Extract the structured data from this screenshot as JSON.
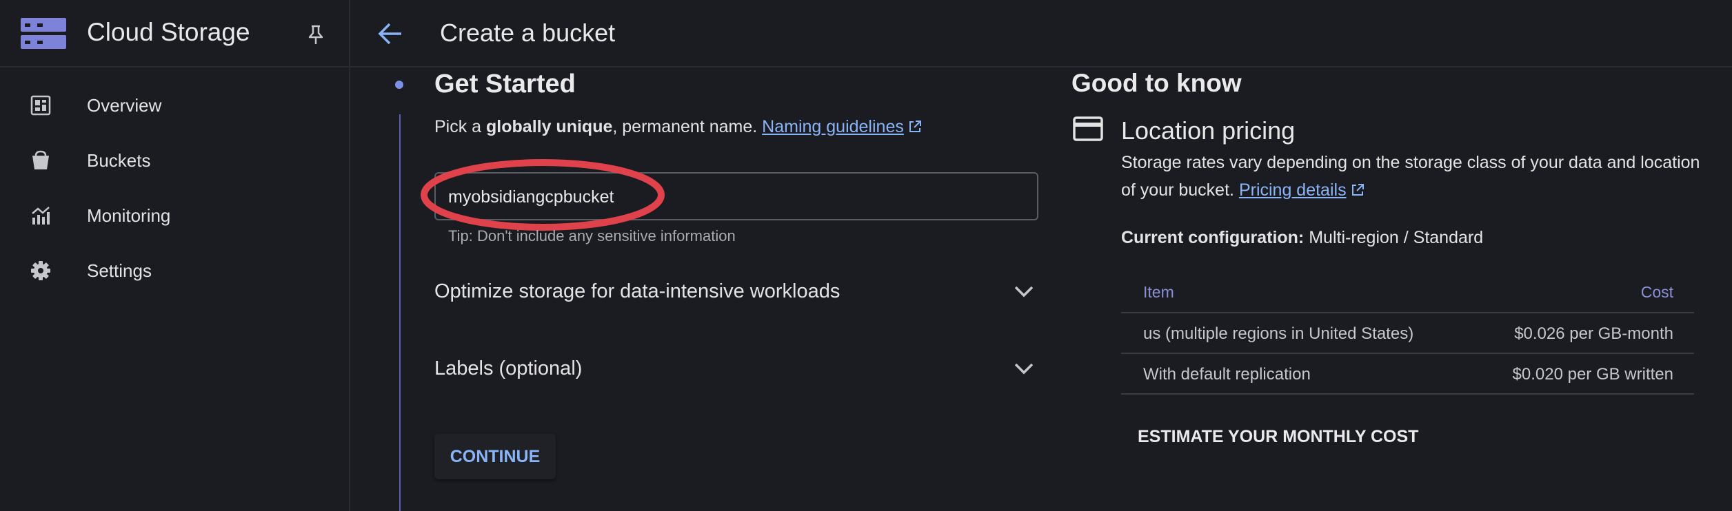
{
  "app": {
    "title": "Cloud Storage",
    "logo_icon": "storage-icon",
    "pin_icon": "pin-icon"
  },
  "sidebar": {
    "items": [
      {
        "label": "Overview",
        "icon": "dashboard-icon"
      },
      {
        "label": "Buckets",
        "icon": "bucket-icon"
      },
      {
        "label": "Monitoring",
        "icon": "chart-icon"
      },
      {
        "label": "Settings",
        "icon": "gear-icon"
      }
    ]
  },
  "header": {
    "back_icon": "arrow-left-icon",
    "title": "Create a bucket"
  },
  "step": {
    "title": "Get Started",
    "intro_prefix": "Pick a ",
    "intro_bold": "globally unique",
    "intro_suffix": ", permanent name. ",
    "naming_link": "Naming guidelines",
    "name_value": "myobsidiangcpbucket",
    "tip": "Tip: Don't include any sensitive information",
    "accordions": [
      {
        "label": "Optimize storage for data-intensive workloads"
      },
      {
        "label": "Labels (optional)"
      }
    ],
    "continue_label": "CONTINUE"
  },
  "good_to_know": {
    "title": "Good to know",
    "card_icon": "credit-card-icon",
    "section_title": "Location pricing",
    "desc": "Storage rates vary depending on the storage class of your data and location of your bucket. ",
    "pricing_link": "Pricing details",
    "config_label": "Current configuration:",
    "config_value": " Multi-region / Standard",
    "table": {
      "headers": [
        "Item",
        "Cost"
      ],
      "rows": [
        [
          "us (multiple regions in United States)",
          "$0.026 per GB-month"
        ],
        [
          "With default replication",
          "$0.020 per GB written"
        ]
      ]
    },
    "estimate_label": "ESTIMATE YOUR MONTHLY COST"
  },
  "colors": {
    "accent": "#8ab4f8",
    "background": "#1b1c21",
    "highlight": "#e0424b",
    "brand": "#7c83d9"
  }
}
